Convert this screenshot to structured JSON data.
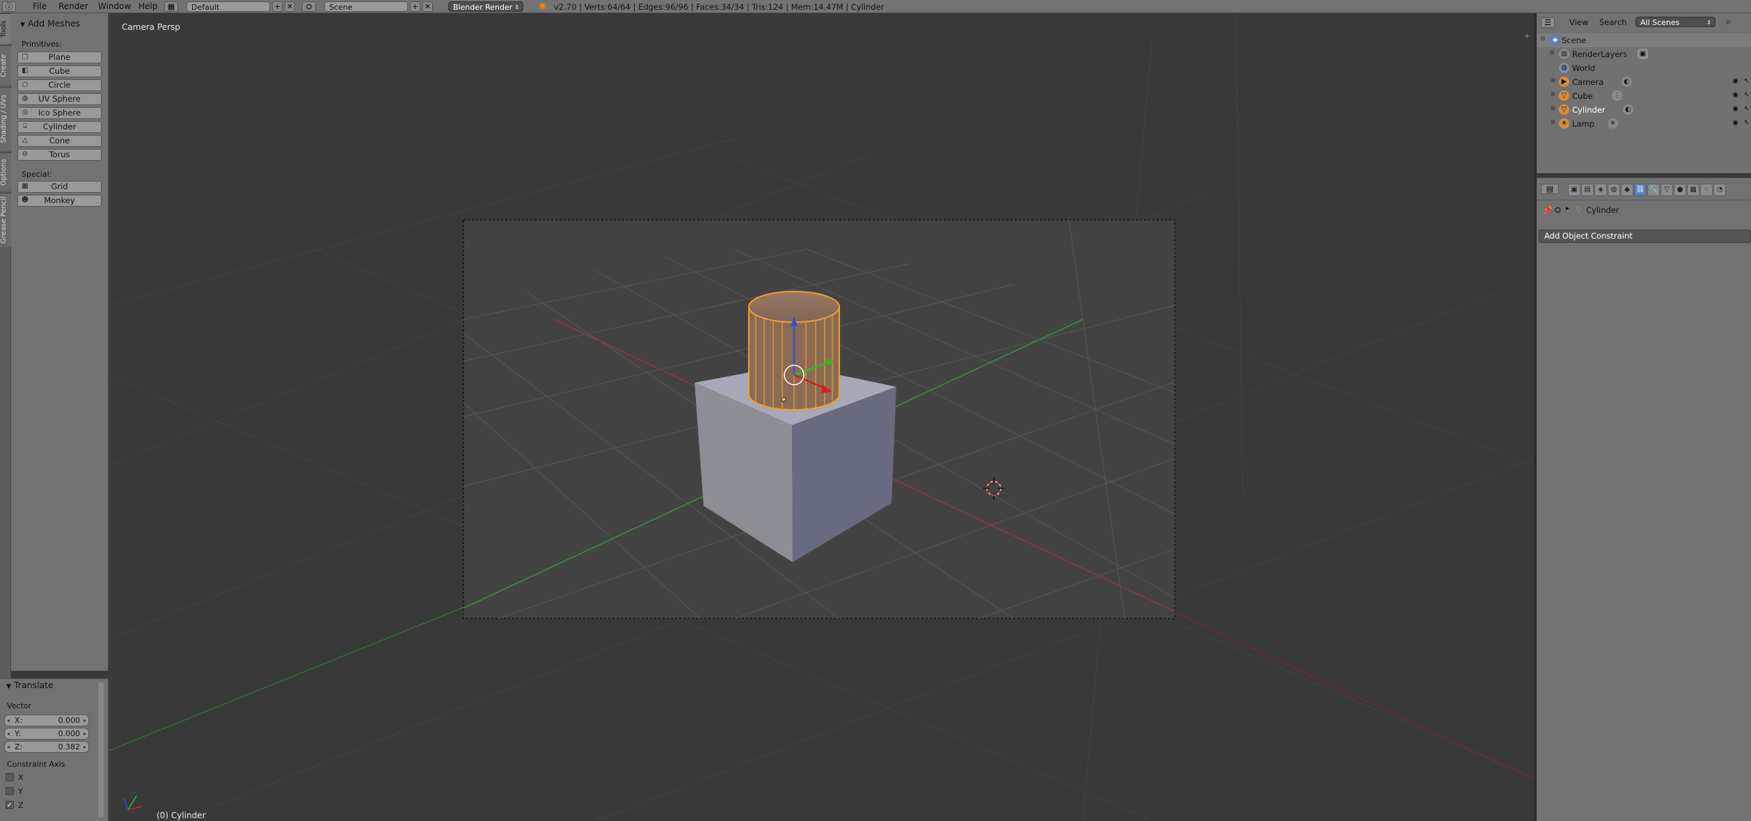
{
  "topbar": {
    "menus": [
      "File",
      "Render",
      "Window",
      "Help"
    ],
    "layout": "Default",
    "scene": "Scene",
    "engine": "Blender Render",
    "stats": "v2.70 | Verts:64/64 | Edges:96/96 | Faces:34/34 | Tris:124 | Mem:14.47M | Cylinder"
  },
  "lefttabs": [
    "Tools",
    "Create",
    "Shading / UVs",
    "Options",
    "Grease Pencil"
  ],
  "toolshelf": {
    "title": "Add Meshes",
    "primitives_label": "Primitives:",
    "primitives": [
      "Plane",
      "Cube",
      "Circle",
      "UV Sphere",
      "Ico Sphere",
      "Cylinder",
      "Cone",
      "Torus"
    ],
    "special_label": "Special:",
    "special": [
      "Grid",
      "Monkey"
    ]
  },
  "operator": {
    "title": "Translate",
    "vector_label": "Vector",
    "x_label": "X:",
    "x": "0.000",
    "y_label": "Y:",
    "y": "0.000",
    "z_label": "Z:",
    "z": "0.382",
    "constraint_label": "Constraint Axis",
    "axes": [
      "X",
      "Y",
      "Z"
    ],
    "axes_checked": [
      false,
      false,
      true
    ]
  },
  "viewport": {
    "view_label": "Camera Persp",
    "object_label": "(0) Cylinder"
  },
  "outliner": {
    "view": "View",
    "search": "Search",
    "filter": "All Scenes",
    "items": [
      "Scene",
      "RenderLayers",
      "World",
      "Camera",
      "Cube",
      "Cylinder",
      "Lamp"
    ]
  },
  "properties": {
    "breadcrumb": "Cylinder",
    "add_constraint": "Add Object Constraint"
  },
  "colors": {
    "selection": "#f2a12e",
    "ui_gray": "#727272",
    "viewport_bg": "#393939",
    "active_tab": "#5680c2"
  }
}
